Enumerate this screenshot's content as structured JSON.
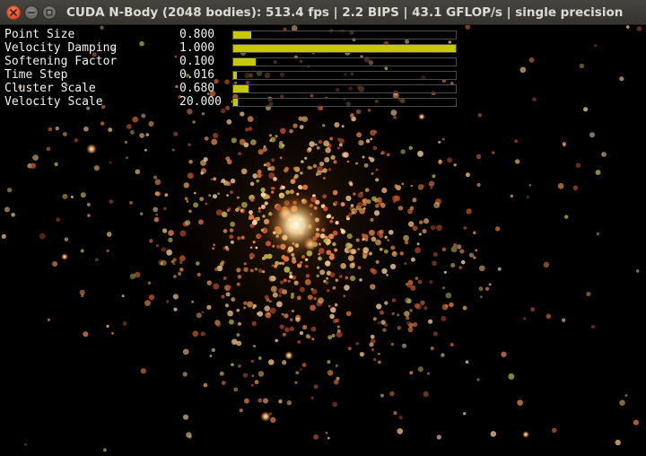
{
  "window": {
    "title": "CUDA N-Body (2048 bodies): 513.4 fps | 2.2 BIPS | 43.1 GFLOP/s | single precision"
  },
  "colors": {
    "slider_fill": "#c8c800",
    "slider_border": "#4a4a4a",
    "label_text": "#f2f2f2",
    "close_button": "#e0522a",
    "titlebar": "#3c3b37"
  },
  "icons": {
    "close": "close-icon",
    "minimize": "minimize-icon",
    "maximize": "maximize-icon"
  },
  "params": [
    {
      "label": "Point Size",
      "value": "0.800",
      "fill_fraction": 0.08
    },
    {
      "label": "Velocity Damping",
      "value": "1.000",
      "fill_fraction": 1.0
    },
    {
      "label": "Softening Factor",
      "value": "0.100",
      "fill_fraction": 0.1
    },
    {
      "label": "Time Step",
      "value": "0.016",
      "fill_fraction": 0.016
    },
    {
      "label": "Cluster Scale",
      "value": "0.680",
      "fill_fraction": 0.068
    },
    {
      "label": "Velocity Scale",
      "value": "20.000",
      "fill_fraction": 0.02
    }
  ]
}
